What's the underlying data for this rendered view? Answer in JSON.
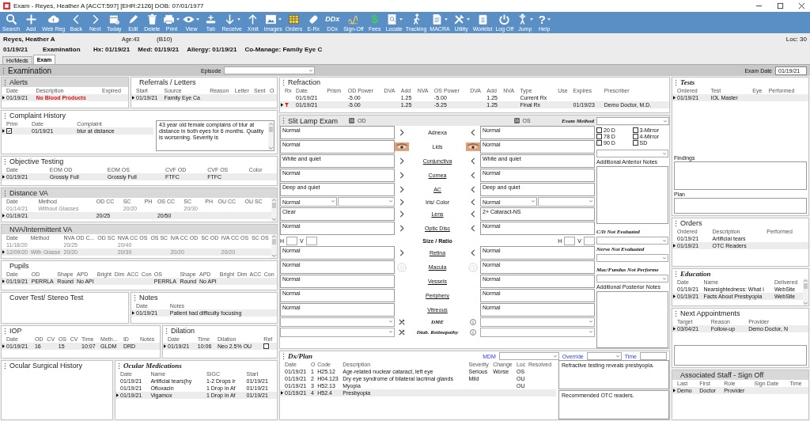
{
  "window": {
    "title": "Exam - Reyes, Heather A [ACCT:597] [EHR:2126] DOB: 07/01/1977"
  },
  "toolbar": [
    {
      "label": "Search",
      "menu": false
    },
    {
      "label": "Add",
      "menu": false
    },
    {
      "label": "Web Reg",
      "menu": false
    },
    {
      "label": "Back",
      "menu": false
    },
    {
      "label": "Next",
      "menu": false
    },
    {
      "label": "Today",
      "menu": false
    },
    {
      "label": "Edit",
      "menu": false
    },
    {
      "label": "Delete",
      "menu": false
    },
    {
      "label": "Print",
      "menu": true
    },
    {
      "label": "View",
      "menu": true
    },
    {
      "label": "Tab",
      "menu": false
    },
    {
      "label": "Receive",
      "menu": true
    },
    {
      "label": "Xmit",
      "menu": false
    },
    {
      "label": "Images",
      "menu": true
    },
    {
      "label": "Orders",
      "menu": false
    },
    {
      "label": "E-Rx",
      "menu": false
    },
    {
      "label": "DDx",
      "menu": false,
      "glyph": "DDx"
    },
    {
      "label": "Sign-Off",
      "menu": false
    },
    {
      "label": "Fees",
      "menu": false,
      "glyph": "$"
    },
    {
      "label": "Locate",
      "menu": true
    },
    {
      "label": "Tracking",
      "menu": false
    },
    {
      "label": "MACRA",
      "menu": true
    },
    {
      "label": "Utility",
      "menu": true
    },
    {
      "label": "Worklist",
      "menu": false
    },
    {
      "label": "Log Off",
      "menu": false
    },
    {
      "label": "Jump",
      "menu": true
    },
    {
      "label": "Help",
      "menu": true,
      "glyph": "?"
    }
  ],
  "patient": {
    "name": "Reyes, Heather A",
    "age": "Age:43",
    "room": "(B10)",
    "loc": "Loc: 30",
    "date": "01/19/21",
    "visit": "Examination",
    "hx": "Hx: 01/19/21",
    "med": "Med: 01/19/21",
    "allergy": "Allergy: 01/19/21",
    "comanage": "Co-Manage: Family Eye C"
  },
  "tabs": [
    {
      "label": "Hx/Meds",
      "selected": false
    },
    {
      "label": "Exam",
      "selected": true
    }
  ],
  "exam_bar": {
    "title": "Examination",
    "episode_label": "Episode",
    "exam_date_label": "Exam Date",
    "exam_date": "01/19/21"
  },
  "left_column": [
    {
      "panels": [
        {
          "title": "Alerts",
          "grip": true,
          "shaded": true,
          "italic": false,
          "columns": [
            "Date",
            "Description",
            "Expired"
          ],
          "rows": [
            {
              "selected": true,
              "cells": [
                "01/19/21",
                {
                  "kind": "alert",
                  "text": "No Blood Products"
                },
                ""
              ]
            }
          ]
        },
        {
          "title": "Referrals / Letters",
          "grip": false,
          "shaded": false,
          "italic": false,
          "columns": [
            "Start",
            "Source",
            "Reason",
            "Letter",
            "Sent",
            "O"
          ],
          "rows": [
            {
              "selected": true,
              "cells": [
                "01/19/21",
                "Family Eye Ca",
                "",
                "",
                "",
                ""
              ]
            }
          ]
        }
      ]
    },
    {
      "panels": [
        {
          "title": "Complaint History",
          "grip": true,
          "shaded": false,
          "italic": false,
          "columns": [
            "Prim",
            "Date",
            "Complaint"
          ],
          "rows": [
            {
              "selected": true,
              "cells": [
                {
                  "kind": "checkbox",
                  "checked": true
                },
                "01/19/21",
                "blur at distance"
              ]
            }
          ],
          "note": "43 year old female complains of blur at distance in both eyes for 6 months. Quality is worsening.  Severity is"
        }
      ]
    },
    {
      "panels": [
        {
          "title": "Objective Testing",
          "grip": true,
          "shaded": false,
          "italic": false,
          "columns": [
            "Date",
            "EOM OD",
            "EOM OS",
            "CVF OD",
            "CVF OS",
            "Color"
          ],
          "rows": [
            {
              "selected": true,
              "cells": [
                "01/19/21",
                "Grossly Full",
                "Grossly Full",
                "FTFC",
                "FTFC",
                ""
              ]
            }
          ]
        }
      ]
    },
    {
      "panels": [
        {
          "title": "Distance VA",
          "grip": true,
          "shaded": true,
          "italic": false,
          "scrollbar": true,
          "columns": [
            "Date",
            "Method",
            "OD CC",
            "SC",
            "PH",
            "OS CC",
            "SC",
            "PH",
            "OU CC",
            "OU SC"
          ],
          "rows": [
            {
              "selected": false,
              "dimmed": true,
              "cells": [
                "01/14/21",
                "Without Glasses",
                "",
                "20/20",
                "",
                "",
                "20/30",
                "",
                "",
                ""
              ]
            },
            {
              "selected": true,
              "dimmed": false,
              "cells": [
                "01/19/21",
                "",
                "20/25",
                "",
                "",
                "20/50",
                "",
                "",
                "",
                ""
              ]
            }
          ]
        }
      ]
    },
    {
      "panels": [
        {
          "title": "NVA/Intermittent VA",
          "grip": false,
          "shaded": true,
          "italic": false,
          "scrollbar": true,
          "columns": [
            "Date",
            "Method",
            "NVA OD C...",
            "OD SC",
            "NVA CC OS",
            "OS SC",
            "IVA CC OD",
            "SC OD",
            "IVA CC OS",
            "SC OS"
          ],
          "rows": [
            {
              "selected": false,
              "dimmed": true,
              "cells": [
                "11/18/20",
                "",
                "20/25",
                "",
                "20/40",
                "",
                "",
                "",
                "",
                ""
              ]
            },
            {
              "selected": true,
              "dimmed": true,
              "cells": [
                "12/09/20",
                "With Glasse",
                "20/20",
                "",
                "20/30",
                "",
                "20/20",
                "",
                "20/20",
                ""
              ]
            }
          ]
        }
      ]
    },
    {
      "panels": [
        {
          "title": "Pupils",
          "grip": false,
          "shaded": false,
          "italic": false,
          "columns": [
            "Date",
            "OD",
            "Shape",
            "APD",
            "Bright",
            "Dim",
            "ACC",
            "Con",
            "OS",
            "Shape",
            "APD",
            "Bright",
            "Dim",
            "ACC",
            "Con"
          ],
          "rows": [
            {
              "selected": true,
              "cells": [
                "01/19/21",
                "PERRLA",
                "Round",
                "No API",
                "",
                "",
                "",
                "",
                "PERRLA",
                "Round",
                "No API",
                "",
                "",
                "",
                ""
              ]
            }
          ]
        }
      ]
    },
    {
      "panels": [
        {
          "title": "Cover Test/ Stereo Test",
          "grip": false,
          "shaded": false,
          "italic": false
        },
        {
          "title": "Notes",
          "grip": true,
          "shaded": false,
          "italic": false,
          "columns": [
            "Date",
            "Notes"
          ],
          "rows": [
            {
              "selected": true,
              "cells": [
                "01/19/21",
                "Patient had difficulty focusing"
              ]
            }
          ]
        }
      ]
    },
    {
      "panels": [
        {
          "title": "IOP",
          "grip": true,
          "shaded": false,
          "italic": false,
          "columns": [
            "Date",
            "OD",
            "CV",
            "OS",
            "CV",
            "Time",
            "Meth...",
            "ID",
            "Notes"
          ],
          "rows": [
            {
              "selected": true,
              "cells": [
                "01/19/21",
                "16",
                "",
                "15",
                "",
                "10:07",
                "GLDM",
                "DRD",
                ""
              ]
            }
          ]
        },
        {
          "title": "Dilation",
          "grip": true,
          "shaded": false,
          "italic": false,
          "columns": [
            "Date",
            "Time",
            "Dilation",
            "Ref"
          ],
          "rows": [
            {
              "selected": true,
              "cells": [
                "01/19/21",
                "10:06",
                "Neo 2.5% OU",
                {
                  "kind": "checkbox",
                  "checked": false
                }
              ]
            }
          ]
        }
      ]
    },
    {
      "panels": [
        {
          "title": "Ocular Surgical History",
          "grip": true,
          "shaded": false,
          "italic": false
        },
        {
          "title": "Ocular Medications",
          "grip": true,
          "shaded": false,
          "italic": true,
          "columns": [
            "Date",
            "Name",
            "SIGC",
            "Start"
          ],
          "rows": [
            {
              "selected": false,
              "cells": [
                "01/19/21",
                "Artificial tears(hy",
                "1-2 Drops ir",
                "01/19/21"
              ]
            },
            {
              "selected": false,
              "cells": [
                "01/19/21",
                "Ofloxacin",
                "1 Drop in Af",
                "01/19/21"
              ]
            },
            {
              "selected": true,
              "cells": [
                "01/19/21",
                "Vigamox",
                "1 Drop in Af",
                "01/19/21"
              ]
            }
          ]
        }
      ]
    }
  ],
  "middle_column": [
    {
      "panels": [
        {
          "title": "Refraction",
          "grip": true,
          "shaded": false,
          "italic": false,
          "columns": [
            "Rx",
            "Date",
            "Prism",
            "OD Power",
            "DVA",
            "Add",
            "NVA",
            "OS Power",
            "DVA",
            "Add",
            "NVA",
            "Type",
            "Use",
            "Expires",
            "Prescriber"
          ],
          "rows": [
            {
              "selected": false,
              "cells": [
                "",
                "01/19/21",
                "",
                "-5.00",
                "",
                "1.25",
                "",
                "-5.00",
                "",
                "1.25",
                "",
                "Current Rx",
                "",
                "",
                ""
              ]
            },
            {
              "selected": true,
              "cells": [
                {
                  "kind": "flag"
                },
                "01/19/21",
                "",
                "-5.00",
                "",
                "1.25",
                "",
                "-5.25",
                "",
                "1.25",
                "",
                "Final Rx",
                "",
                "01/19/23",
                "Demo Doctor, M.D."
              ]
            }
          ]
        }
      ]
    },
    {
      "panels": [
        {
          "title": "Slit Lamp Exam",
          "grip": true,
          "shaded": true,
          "italic": false,
          "slit": {
            "od_label": "OD",
            "os_label": "OS",
            "method_label": "Exam Method",
            "rows": [
              {
                "label": "Adnexa",
                "kind": "arrows",
                "link": false,
                "od": "Normal",
                "os": "Normal"
              },
              {
                "label": "Lids",
                "kind": "eyes",
                "link": false,
                "od": "Normal",
                "os": "Normal"
              },
              {
                "label": "Conjunctiva",
                "kind": "arrows",
                "link": true,
                "od": "White and quiet",
                "os": "White and quiet"
              },
              {
                "label": "Cornea",
                "kind": "arrows",
                "link": true,
                "od": "Normal",
                "os": "Normal"
              },
              {
                "label": "AC",
                "kind": "arrows",
                "link": true,
                "od": "Deep and quiet",
                "os": "Deep and quiet"
              },
              {
                "label": "Iris/ Color",
                "kind": "choice",
                "link": false,
                "od": "Normal",
                "os": "Normal"
              },
              {
                "label": "Lens",
                "kind": "arrows",
                "link": true,
                "od": "Clear",
                "os": "2+ Cataract-NS"
              },
              {
                "label": "Optic Disc",
                "kind": "arrows",
                "link": true,
                "od": "Normal",
                "os": "Normal"
              },
              {
                "label": "Size / Ratio",
                "kind": "measure",
                "od_h_label": "H",
                "od_v_label": "V",
                "os_h_label": "H",
                "os_v_label": "V"
              },
              {
                "label": "Retina",
                "kind": "arrows",
                "link": true,
                "od": "Normal",
                "os": "Normal"
              },
              {
                "label": "Macula",
                "kind": "circles",
                "link": true,
                "od": "Normal",
                "os": "Normal"
              },
              {
                "label": "Vessels",
                "kind": "plain",
                "link": true,
                "od": "Normal",
                "os": "Normal"
              },
              {
                "label": "Periphery",
                "kind": "plain",
                "link": true,
                "od": "Normal",
                "os": "Normal"
              },
              {
                "label": "Vitreous",
                "kind": "plain",
                "link": true,
                "od": "Normal",
                "os": "Normal"
              },
              {
                "label": "DME",
                "kind": "tools"
              },
              {
                "label": "Diab. Retinopathy",
                "kind": "tools"
              }
            ],
            "sidebar": {
              "lenses": [
                {
                  "label": "20 D",
                  "checked": false
                },
                {
                  "label": "3-Mirror",
                  "checked": false
                },
                {
                  "label": "78 D",
                  "checked": false
                },
                {
                  "label": "4-Mirror",
                  "checked": false
                },
                {
                  "label": "90 D",
                  "checked": false
                },
                {
                  "label": "SD",
                  "checked": false
                }
              ],
              "anterior_label": "Additional Anterior Notes",
              "cd_label": "C/D Not Evaluated",
              "nerve_label": "Nerve Not Evaluated",
              "mac_label": "Mac/Fundus Not Performe",
              "posterior_label": "Additional Posterior Notes"
            }
          }
        }
      ]
    },
    {
      "panels": [
        {
          "title": "Dx/Plan",
          "grip": true,
          "shaded": false,
          "italic": true,
          "dx_controls": {
            "mdm_label": "MDM",
            "override_label": "Override",
            "time_label": "Time"
          },
          "columns": [
            "Date",
            "O",
            "Code",
            "Description",
            "Severity",
            "Change",
            "Loc",
            "Resolved"
          ],
          "rows": [
            {
              "selected": false,
              "cells": [
                "01/19/21",
                "1",
                "H25.12",
                "Age-related nuclear cataract, left eye",
                "Serious",
                "Worse",
                "OS",
                ""
              ]
            },
            {
              "selected": false,
              "cells": [
                "01/19/21",
                "2",
                "H04.123",
                "Dry eye syndrome of bilateral lacrimal glands",
                "Mild",
                "",
                "OU",
                ""
              ]
            },
            {
              "selected": false,
              "cells": [
                "01/19/21",
                "3",
                "H52.13",
                "Myopia",
                "",
                "",
                "OU",
                ""
              ]
            },
            {
              "selected": true,
              "cells": [
                "01/19/21",
                "4",
                "H52.4",
                "Presbyopia",
                "",
                "",
                "",
                ""
              ]
            }
          ],
          "plan_notes": [
            "Refractive testing reveals presbyopia.",
            "Recommended OTC readers."
          ]
        }
      ]
    }
  ],
  "right_column": [
    {
      "panels": [
        {
          "title": "Tests",
          "grip": true,
          "shaded": false,
          "italic": true,
          "columns": [
            "Ordered",
            "Test",
            "Eye",
            "Performed"
          ],
          "rows": [
            {
              "selected": true,
              "cells": [
                "01/19/21",
                "IOL Master",
                "",
                ""
              ]
            }
          ],
          "fields": [
            {
              "label": "Findings"
            },
            {
              "label": "Plan"
            }
          ]
        }
      ]
    },
    {
      "panels": [
        {
          "title": "Orders",
          "grip": true,
          "shaded": false,
          "italic": false,
          "columns": [
            "Ordered",
            "Description",
            "Performed"
          ],
          "rows": [
            {
              "selected": false,
              "cells": [
                "01/19/21",
                "Artificial tears",
                ""
              ]
            },
            {
              "selected": true,
              "cells": [
                "01/19/21",
                "OTC Readers",
                ""
              ]
            }
          ]
        }
      ]
    },
    {
      "panels": [
        {
          "title": "Education",
          "grip": true,
          "shaded": false,
          "italic": true,
          "scrollbar": true,
          "columns": [
            "Date",
            "Name",
            "Delivered"
          ],
          "rows": [
            {
              "selected": false,
              "cells": [
                "01/19/21",
                "Nearsightedness: What i",
                "WebSite"
              ]
            },
            {
              "selected": true,
              "cells": [
                "01/19/21",
                "Facts About Presbyopia",
                "WebSite"
              ]
            }
          ]
        }
      ]
    },
    {
      "panels": [
        {
          "title": "Next Appointments",
          "grip": true,
          "shaded": false,
          "italic": false,
          "columns": [
            "Target",
            "Reason",
            "Provider"
          ],
          "rows": [
            {
              "selected": true,
              "cells": [
                "03/04/21",
                "Follow-up",
                "Demo Doctor, N"
              ]
            }
          ],
          "notes_box": true
        }
      ]
    },
    {
      "panels": [
        {
          "title": "Associated Staff - Sign Off",
          "grip": false,
          "shaded": true,
          "italic": false,
          "columns": [
            "Last",
            "First",
            "Role",
            "Sign Date",
            "Time"
          ],
          "rows": [
            {
              "selected": true,
              "cells": [
                "Demo",
                "Doctor",
                "Provider",
                "",
                ""
              ]
            }
          ]
        }
      ]
    }
  ]
}
